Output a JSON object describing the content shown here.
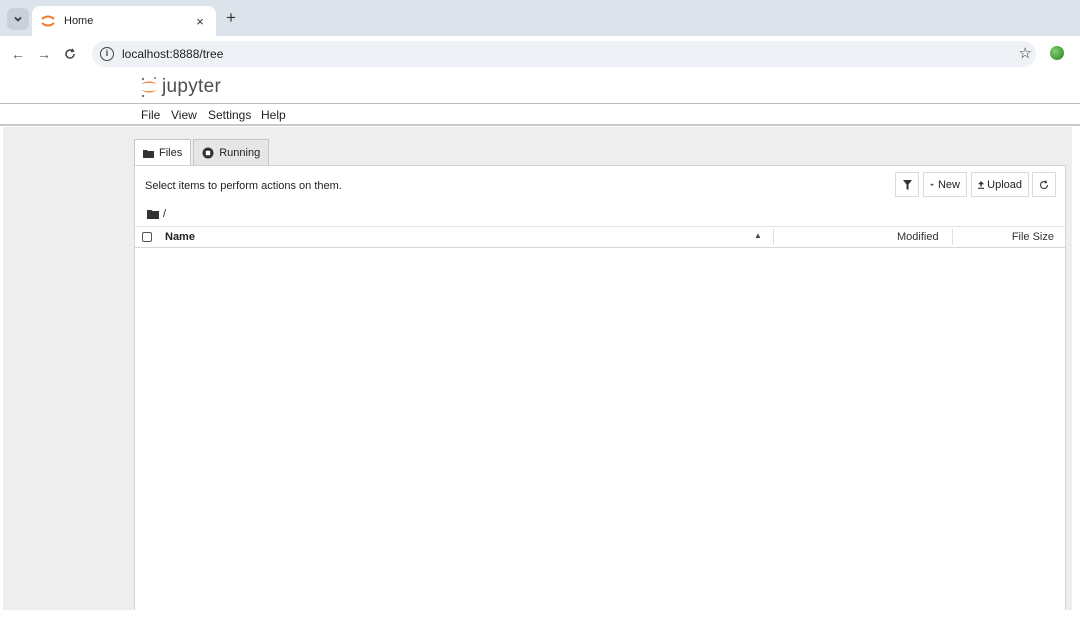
{
  "browser": {
    "tab_title": "Home",
    "tab_close": "×",
    "new_tab": "+",
    "tab_menu": "⌄",
    "url": "localhost:8888/tree",
    "back": "←",
    "forward": "→",
    "reload": "C",
    "bookmark": "☆"
  },
  "jupyter": {
    "logo_text": "jupyter",
    "accent": "#f37726",
    "menu": [
      "File",
      "View",
      "Settings",
      "Help"
    ],
    "tabs": [
      {
        "label": "Files",
        "icon": "folder-icon",
        "active": true
      },
      {
        "label": "Running",
        "icon": "running-icon",
        "active": false
      }
    ],
    "toolbar": {
      "hint": "Select items to perform actions on them.",
      "new_label": "New",
      "upload_label": "Upload"
    },
    "breadcrumb": "/",
    "columns": {
      "name": "Name",
      "modified": "Modified",
      "size": "File Size"
    }
  }
}
